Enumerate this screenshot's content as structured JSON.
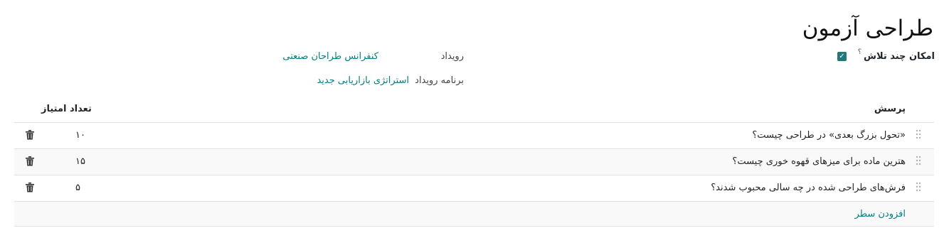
{
  "page": {
    "title": "طراحی آزمون"
  },
  "form": {
    "multi_attempt_label": "امکان چند تلاش",
    "multi_attempt_help": "؟",
    "multi_attempt_checked": true,
    "event_label": "رویداد",
    "event_value": "کنفرانس طراحان صنعتی",
    "event_track_label": "برنامه رویداد",
    "event_track_value": "استراتژی بازاریابی جدید"
  },
  "table": {
    "columns": {
      "question": "پرسش",
      "score": "تعداد امتیاز"
    },
    "rows": [
      {
        "question": "«تحول بزرگ بعدی» در طراحی چیست؟",
        "score": "۱۰"
      },
      {
        "question": "هترین ماده برای میزهای قهوه خوری چیست؟",
        "score": "۱۵"
      },
      {
        "question": "فرش‌های طراحی شده در چه سالی محبوب شدند؟",
        "score": "۵"
      }
    ],
    "add_line": "افزودن سطر"
  },
  "colors": {
    "link": "#017e84",
    "checkbox": "#1f7a7a",
    "row_alt": "#f9f9f9",
    "border": "#dee2e6"
  },
  "icons": {
    "drag": "drag-handle-icon",
    "delete": "trash-icon",
    "check": "check-icon"
  }
}
